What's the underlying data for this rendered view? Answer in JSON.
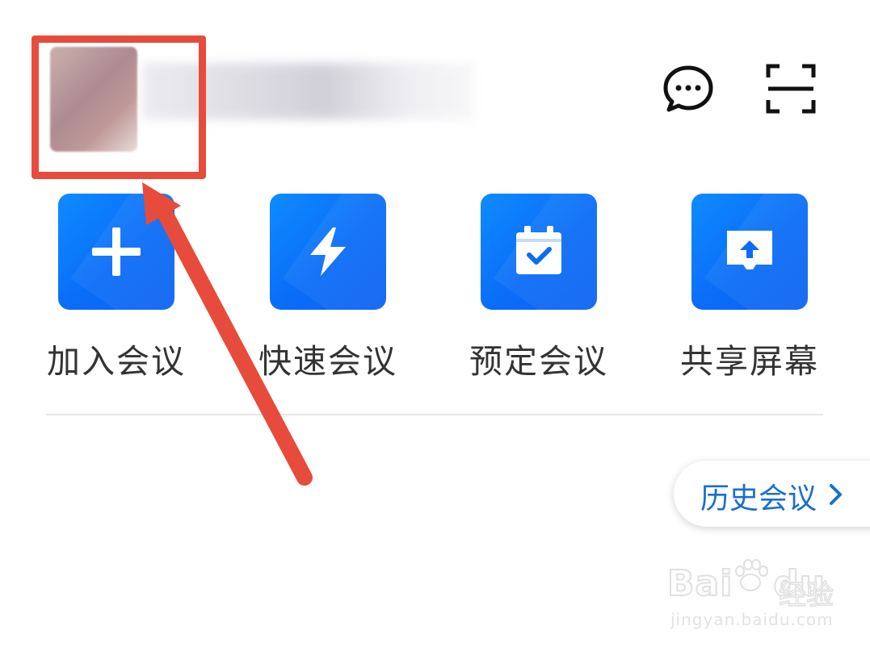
{
  "header": {
    "avatar_icon": "user-avatar-blurred",
    "chat_icon": "chat-bubble-icon",
    "scan_icon": "scan-icon"
  },
  "actions": [
    {
      "label": "加入会议",
      "icon": "plus-icon"
    },
    {
      "label": "快速会议",
      "icon": "lightning-icon"
    },
    {
      "label": "预定会议",
      "icon": "calendar-check-icon"
    },
    {
      "label": "共享屏幕",
      "icon": "screen-share-icon"
    }
  ],
  "history": {
    "label": "历史会议",
    "icon": "chevron-right-icon"
  },
  "watermark": {
    "logo": "Bai",
    "logo2": "du",
    "text": "经验",
    "url": "jingyan.baidu.com"
  },
  "colors": {
    "accent_blue": "#0a6cf7",
    "highlight_red": "#e74b3c",
    "history_text": "#1a6ecf"
  }
}
